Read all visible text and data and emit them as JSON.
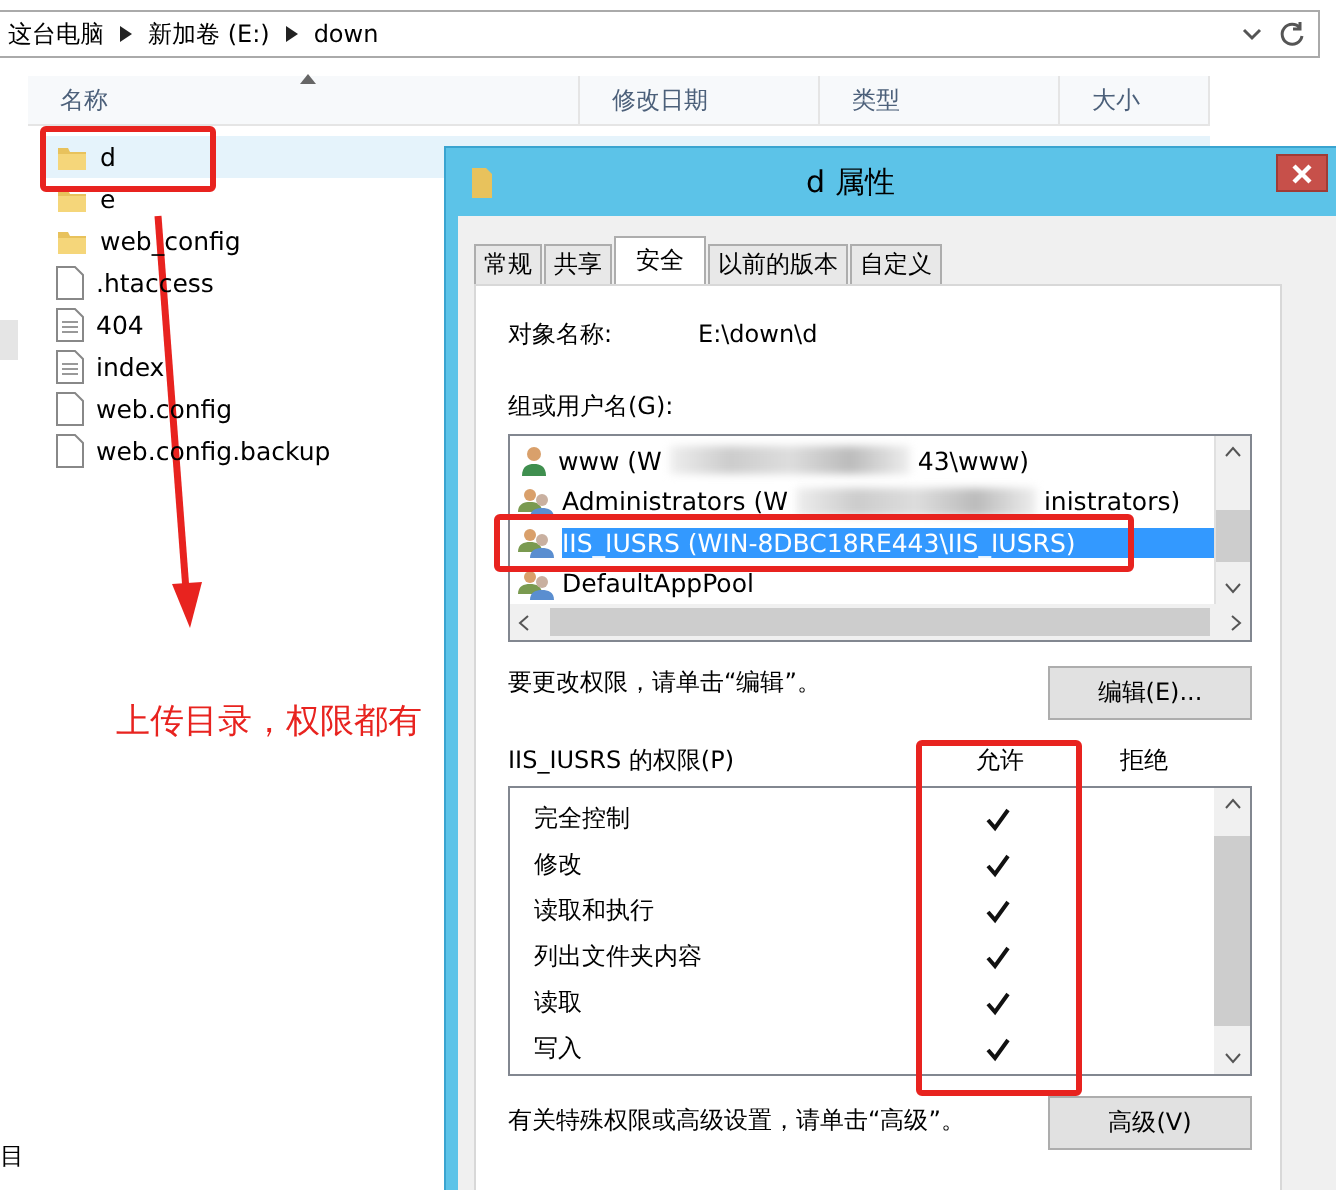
{
  "address_bar": {
    "path": [
      "这台电脑",
      "新加卷 (E:)",
      "down"
    ]
  },
  "file_list": {
    "columns": [
      "名称",
      "修改日期",
      "类型",
      "大小"
    ],
    "rows": [
      {
        "name": "d",
        "kind": "folder",
        "selected": true
      },
      {
        "name": "e",
        "kind": "folder",
        "selected": false
      },
      {
        "name": "web_config",
        "kind": "folder",
        "selected": false
      },
      {
        "name": ".htaccess",
        "kind": "file",
        "selected": false
      },
      {
        "name": "404",
        "kind": "text",
        "selected": false
      },
      {
        "name": "index",
        "kind": "text",
        "selected": false
      },
      {
        "name": "web.config",
        "kind": "file",
        "selected": false
      },
      {
        "name": "web.config.backup",
        "kind": "file",
        "selected": false
      }
    ]
  },
  "nav_pane": {
    "cut_label": "目"
  },
  "dialog": {
    "title": "d 属性",
    "tabs": [
      {
        "label": "常规",
        "selected": false
      },
      {
        "label": "共享",
        "selected": false
      },
      {
        "label": "安全",
        "selected": true
      },
      {
        "label": "以前的版本",
        "selected": false
      },
      {
        "label": "自定义",
        "selected": false
      }
    ],
    "object_label": "对象名称:",
    "object_value": "E:\\down\\d",
    "users_label": "组或用户名(G):",
    "users": [
      {
        "kind": "user",
        "visible_start": "www (W",
        "visible_end": "43\\www)",
        "selected": false
      },
      {
        "kind": "group",
        "visible_start": "Administrators (W",
        "visible_end": "inistrators)",
        "selected": false
      },
      {
        "kind": "group",
        "visible_start": "IIS_IUSRS (WIN-8DBC18RE443\\IIS_IUSRS)",
        "selected": true
      },
      {
        "kind": "group",
        "visible_start": "DefaultAppPool",
        "selected": false
      }
    ],
    "edit_hint": "要更改权限，请单击“编辑”。",
    "edit_button": "编辑(E)...",
    "permissions_label": "IIS_IUSRS 的权限(P)",
    "allow_header": "允许",
    "deny_header": "拒绝",
    "permissions": [
      {
        "name": "完全控制",
        "allow": true
      },
      {
        "name": "修改",
        "allow": true
      },
      {
        "name": "读取和执行",
        "allow": true
      },
      {
        "name": "列出文件夹内容",
        "allow": true
      },
      {
        "name": "读取",
        "allow": true
      },
      {
        "name": "写入",
        "allow": true
      }
    ],
    "advanced_hint": "有关特殊权限或高级设置，请单击“高级”。",
    "advanced_button": "高级(V)"
  },
  "annotation": {
    "note": "上传目录，权限都有"
  }
}
